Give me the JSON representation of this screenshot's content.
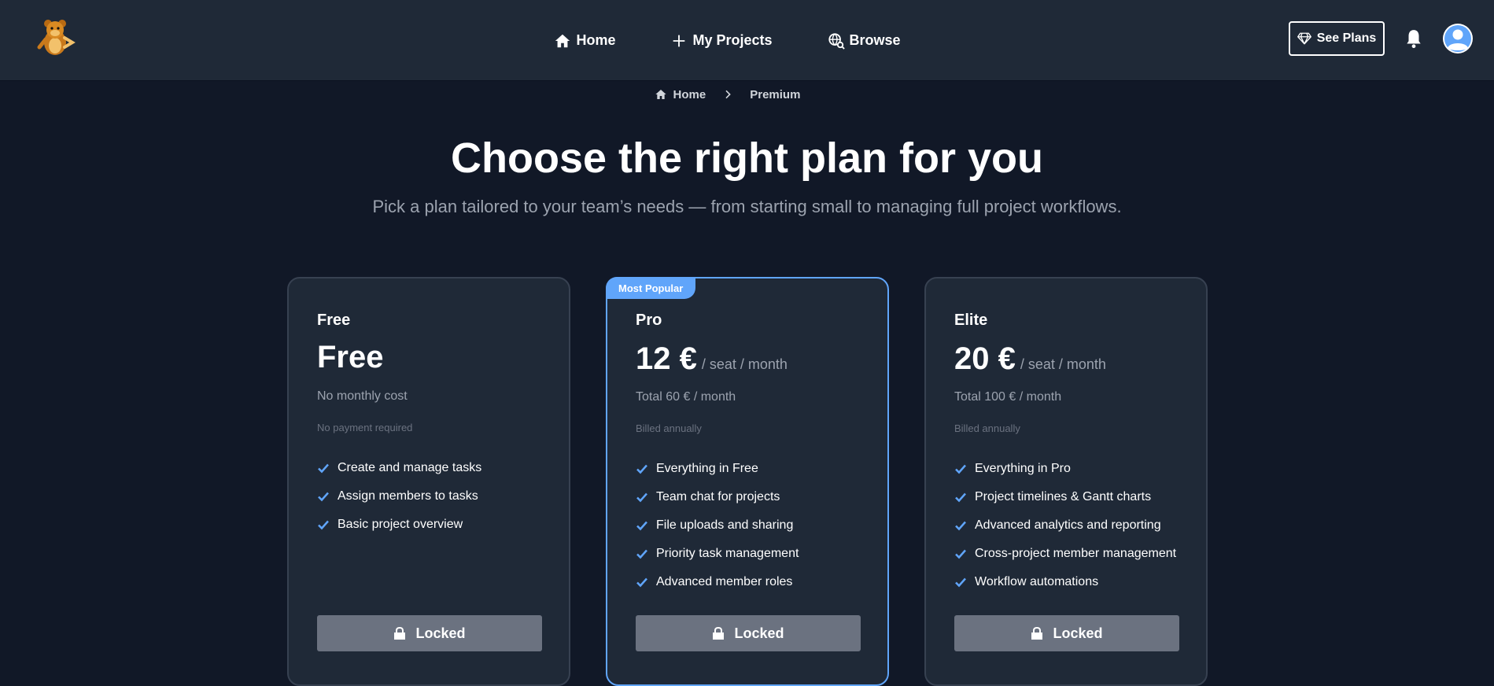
{
  "nav": {
    "items": [
      {
        "label": "Home",
        "icon": "home-icon"
      },
      {
        "label": "My Projects",
        "icon": "plus-icon"
      },
      {
        "label": "Browse",
        "icon": "globe-search-icon"
      }
    ],
    "see_plans_label": "See Plans"
  },
  "breadcrumb": {
    "items": [
      "Home",
      "Premium"
    ]
  },
  "hero": {
    "title": "Choose the right plan for you",
    "subtitle": "Pick a plan tailored to your team’s needs — from starting small to managing full project workflows."
  },
  "plans": [
    {
      "name": "Free",
      "price": "Free",
      "price_unit": "",
      "total": "No monthly cost",
      "billing": "No payment required",
      "features": [
        "Create and manage tasks",
        "Assign members to tasks",
        "Basic project overview"
      ],
      "button_label": "Locked"
    },
    {
      "badge": "Most Popular",
      "name": "Pro",
      "price": "12 €",
      "price_unit": "/ seat / month",
      "total": "Total 60 € / month",
      "billing": "Billed annually",
      "features": [
        "Everything in Free",
        "Team chat for projects",
        "File uploads and sharing",
        "Priority task management",
        "Advanced member roles"
      ],
      "button_label": "Locked"
    },
    {
      "name": "Elite",
      "price": "20 €",
      "price_unit": "/ seat / month",
      "total": "Total 100 € / month",
      "billing": "Billed annually",
      "features": [
        "Everything in Pro",
        "Project timelines & Gantt charts",
        "Advanced analytics and reporting",
        "Cross-project member management",
        "Workflow automations"
      ],
      "button_label": "Locked"
    }
  ],
  "colors": {
    "background": "#111827",
    "surface": "#1f2937",
    "accent": "#60a5fa",
    "button": "#6b7280"
  }
}
